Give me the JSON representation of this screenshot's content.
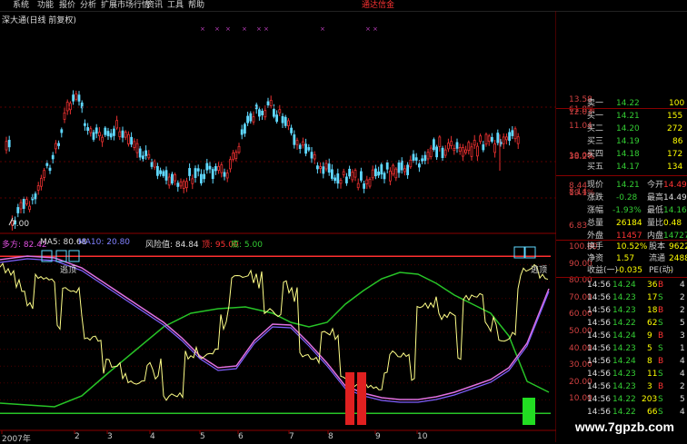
{
  "menu": {
    "items": [
      "系统",
      "功能",
      "报价",
      "分析",
      "扩展市场行情",
      "资讯",
      "工具",
      "帮助"
    ],
    "brand": "通达信金"
  },
  "stock_title": "深大通(日线 前复权)",
  "main_chart": {
    "low_marker": "7.00",
    "ticks_right": [
      "13.58",
      "12.03",
      "11.04",
      "10.00",
      "8.44",
      "8.14",
      "6.83"
    ],
    "fib_labels": [
      "61.8%",
      "38.2%",
      "19.1%"
    ]
  },
  "indicator": {
    "name_label": "多方: 82.42",
    "ma5_label": "MA5: 80.68",
    "ma10_label": "MA10: 20.80",
    "risk_label": "风险值: 84.84",
    "top_label": "顶: 95.00",
    "bottom_label": "底: 5.00",
    "annotations": [
      "逃顶",
      "逃顶"
    ],
    "y_ticks": [
      "100.00",
      "90.00",
      "80.00",
      "70.00",
      "60.00",
      "50.00",
      "40.00",
      "30.00",
      "20.00",
      "10.00"
    ]
  },
  "date_axis": [
    "2007年",
    "2",
    "3",
    "4",
    "5",
    "6",
    "7",
    "8",
    "9",
    "10"
  ],
  "quote": {
    "ask_top_partial": {
      "label": "卖一",
      "price": "14.22",
      "vol": "100"
    },
    "bids": [
      {
        "label": "买一",
        "price": "14.21",
        "vol": "155"
      },
      {
        "label": "买二",
        "price": "14.20",
        "vol": "272"
      },
      {
        "label": "买三",
        "price": "14.19",
        "vol": "86"
      },
      {
        "label": "买四",
        "price": "14.18",
        "vol": "172"
      },
      {
        "label": "买五",
        "price": "14.17",
        "vol": "134"
      }
    ],
    "stats": [
      {
        "l1": "现价",
        "v1": "14.21",
        "l2": "今开",
        "v2": "14.49"
      },
      {
        "l1": "涨跌",
        "v1": "-0.28",
        "l2": "最高",
        "v2": "14.49"
      },
      {
        "l1": "涨幅",
        "v1": "-1.93%",
        "l2": "最低",
        "v2": "14.16"
      },
      {
        "l1": "总量",
        "v1": "26184",
        "l2": "量比",
        "v2": "0.48"
      },
      {
        "l1": "外盘",
        "v1": "11457",
        "l2": "内盘",
        "v2": "14727"
      }
    ],
    "stats2": [
      {
        "l1": "换手",
        "v1": "10.52%",
        "l2": "股本",
        "v2": "9622万"
      },
      {
        "l1": "净资",
        "v1": "1.57",
        "l2": "流通",
        "v2": "2488万"
      },
      {
        "l1": "收益(一)",
        "v1": "-0.035",
        "l2": "PE(动)",
        "v2": "-"
      }
    ],
    "ticks": [
      {
        "time": "14:56",
        "price": "14.24",
        "vol": "36",
        "side": "B",
        "num": "4"
      },
      {
        "time": "14:56",
        "price": "14.23",
        "vol": "17",
        "side": "S",
        "num": "2"
      },
      {
        "time": "14:56",
        "price": "14.23",
        "vol": "18",
        "side": "B",
        "num": "2"
      },
      {
        "time": "14:56",
        "price": "14.22",
        "vol": "62",
        "side": "S",
        "num": "5"
      },
      {
        "time": "14:56",
        "price": "14.24",
        "vol": "9",
        "side": "B",
        "num": "3"
      },
      {
        "time": "14:56",
        "price": "14.23",
        "vol": "5",
        "side": "S",
        "num": "1"
      },
      {
        "time": "14:56",
        "price": "14.24",
        "vol": "8",
        "side": "B",
        "num": "4"
      },
      {
        "time": "14:56",
        "price": "14.23",
        "vol": "11",
        "side": "S",
        "num": "4"
      },
      {
        "time": "14:56",
        "price": "14.23",
        "vol": "3",
        "side": "B",
        "num": "2"
      },
      {
        "time": "14:56",
        "price": "14.22",
        "vol": "203",
        "side": "S",
        "num": "5"
      },
      {
        "time": "14:56",
        "price": "14.22",
        "vol": "66",
        "side": "S",
        "num": "4"
      }
    ]
  },
  "watermark": "www.7gpzb.com",
  "colors": {
    "up": "#e83030",
    "down": "#5fd8ff",
    "green": "#27c427",
    "yellow": "#ffff88",
    "magenta": "#e070e0",
    "purple": "#8060ff",
    "grid_red": "#8a0000",
    "label_red": "#ff5050"
  }
}
